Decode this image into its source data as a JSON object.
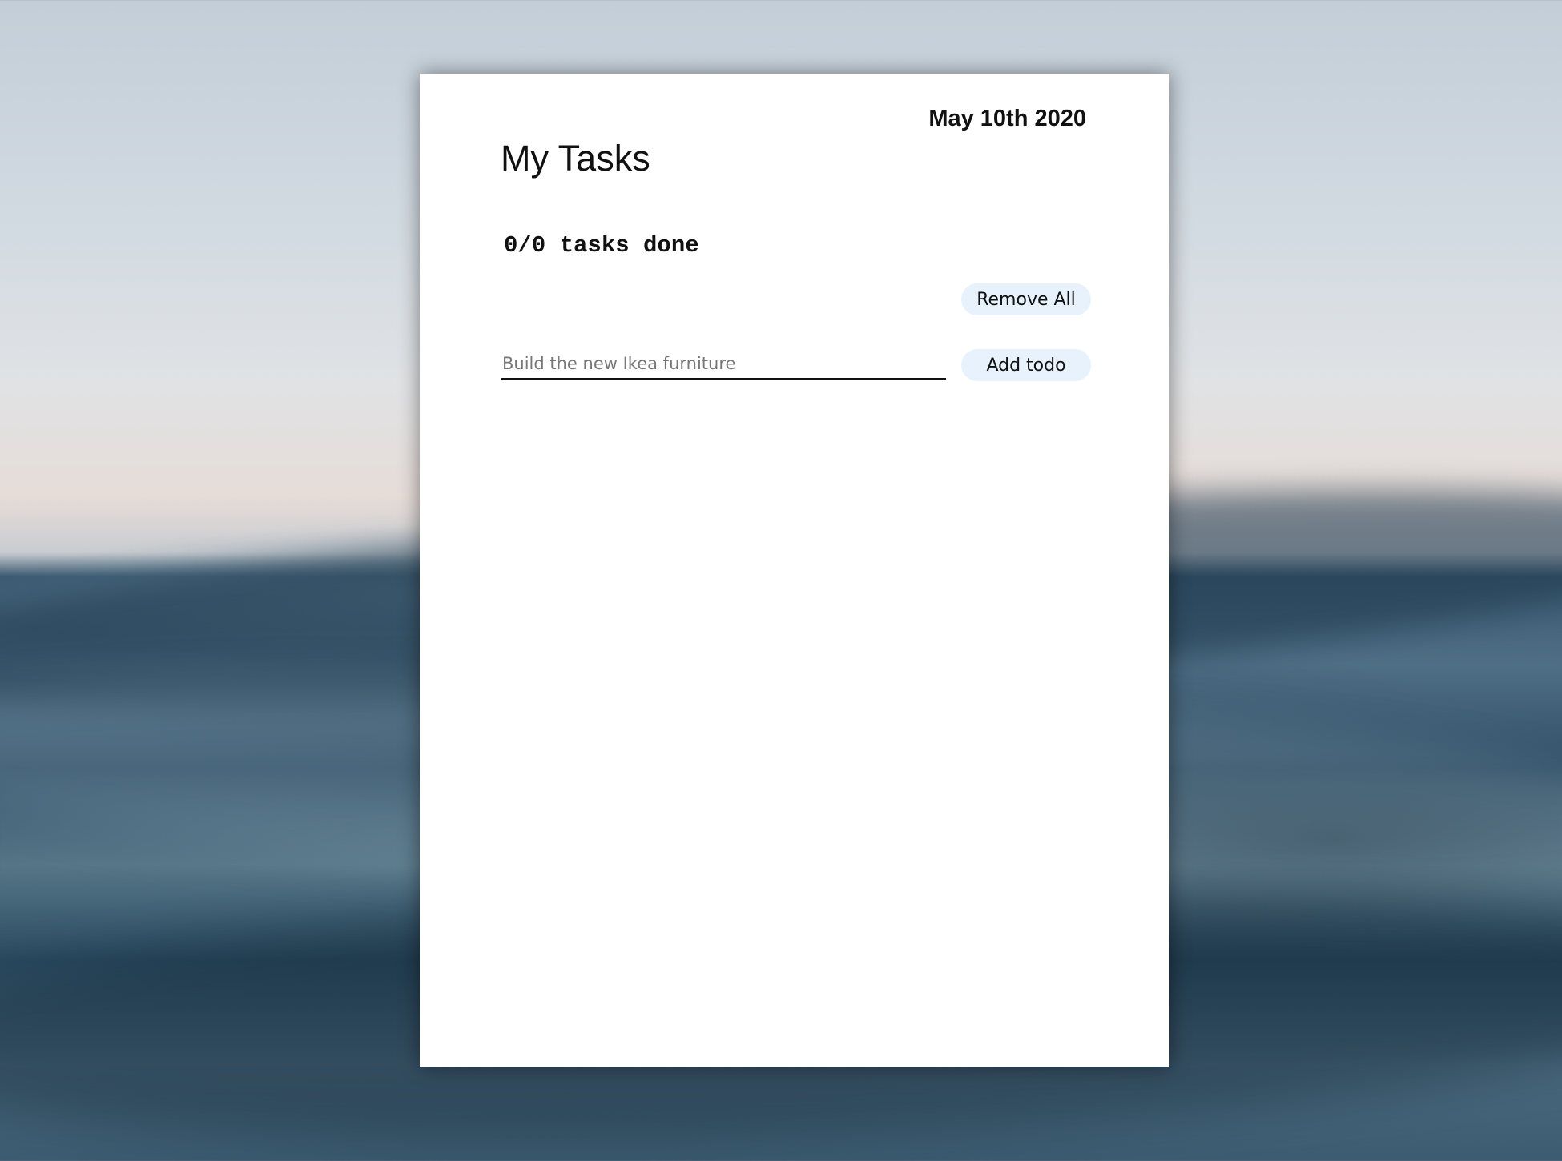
{
  "app": {
    "date": "May 10th 2020",
    "title": "My Tasks"
  },
  "progress": {
    "text": "0/0 tasks done",
    "done": 0,
    "total": 0
  },
  "actions": {
    "remove_all_label": "Remove All",
    "add_todo_label": "Add todo"
  },
  "new_todo": {
    "value": "",
    "placeholder": "Build the new Ikea furniture"
  },
  "todos": []
}
